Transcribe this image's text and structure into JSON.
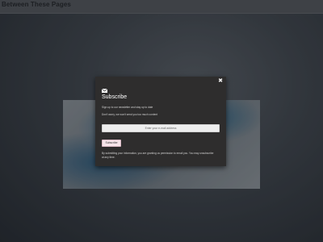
{
  "site": {
    "title": "Between These Pages"
  },
  "modal": {
    "close_icon": "close-icon",
    "mail_icon": "envelope-icon",
    "title": "Subscribe",
    "description": "Sign up to our newsletter and stay up to date",
    "note": "Don't worry, we won't send you too much content",
    "email_placeholder": "Enter your e-mail address",
    "subscribe_label": "Subscribe",
    "consent": "By submitting your information, you are granting us permission to email you. You may unsubscribe at any time."
  },
  "colors": {
    "background": "#2b2f35",
    "modal_bg": "#2e2d2d",
    "button_bg": "#f6e4ea"
  }
}
